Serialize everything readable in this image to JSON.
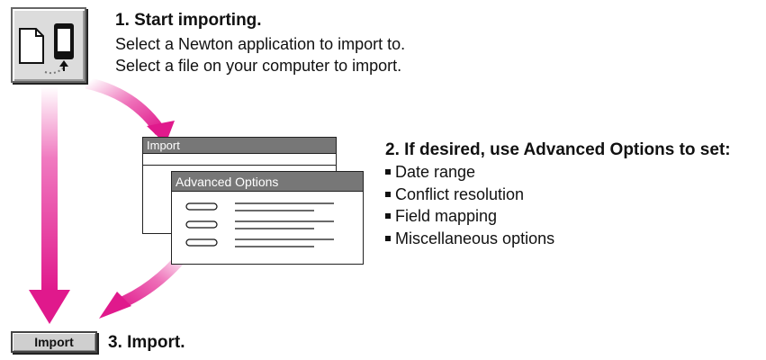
{
  "step1": {
    "title": "1. Start importing.",
    "line1": "Select a Newton application to import to.",
    "line2": "Select a file on your computer to import.",
    "icon": "import-document-to-newton-icon"
  },
  "step2": {
    "title": "2. If desired, use Advanced Options to set:",
    "options": [
      "Date range",
      "Conflict resolution",
      "Field mapping",
      "Miscellaneous options"
    ]
  },
  "step3": {
    "title": "3. Import."
  },
  "import_window": {
    "title": "Import"
  },
  "advanced_window": {
    "title": "Advanced Options"
  },
  "import_button": {
    "label": "Import"
  },
  "colors": {
    "arrow": "#e0198c",
    "window_title": "#777777"
  }
}
